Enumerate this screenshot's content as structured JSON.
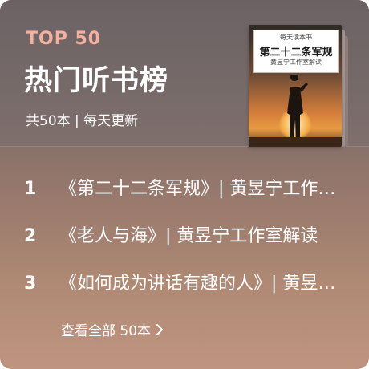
{
  "header": {
    "badge": "TOP 50",
    "badge_color": "#f5b0a0",
    "title": "热门听书榜",
    "subtitle": "共50本 | 每天更新"
  },
  "cover": {
    "series_label": "每天读本书",
    "book_title": "第二十二条军规",
    "author_line": "黄昱宁工作室解读"
  },
  "list": {
    "items": [
      {
        "rank": "1",
        "title": "《第二十二条军规》| 黄昱宁工作室解读"
      },
      {
        "rank": "2",
        "title": "《老人与海》| 黄昱宁工作室解读"
      },
      {
        "rank": "3",
        "title": "《如何成为讲话有趣的人》| 黄昱宁工作室解读"
      }
    ]
  },
  "footer": {
    "view_all": "查看全部 50本"
  }
}
